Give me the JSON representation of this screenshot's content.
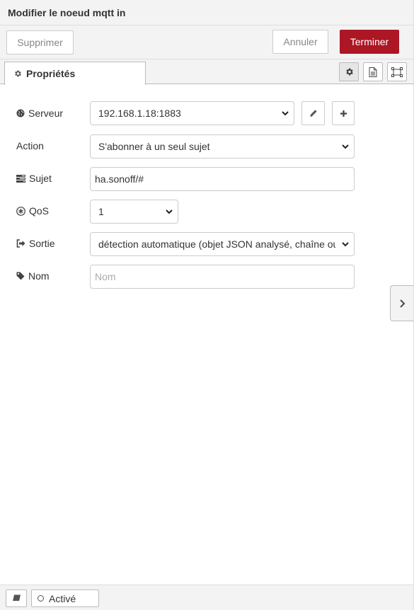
{
  "header": {
    "title": "Modifier le noeud mqtt in"
  },
  "toolbar": {
    "delete_label": "Supprimer",
    "cancel_label": "Annuler",
    "done_label": "Terminer",
    "done_color": "#ad1625"
  },
  "tabs": [
    {
      "label": "Propriétés",
      "icon": "gear-icon"
    }
  ],
  "tab_buttons": [
    {
      "icon": "gear-icon",
      "selected": true
    },
    {
      "icon": "document-icon",
      "selected": false
    },
    {
      "icon": "frame-icon",
      "selected": false
    }
  ],
  "form": {
    "server": {
      "label": "Serveur",
      "icon": "globe-icon",
      "value": "192.168.1.18:1883"
    },
    "action": {
      "label": "Action",
      "value": "S'abonner à un seul sujet"
    },
    "topic": {
      "label": "Sujet",
      "icon": "tasks-icon",
      "value": "ha.sonoff/#"
    },
    "qos": {
      "label": "QoS",
      "icon": "asterisk-circle-icon",
      "value": "1"
    },
    "output": {
      "label": "Sortie",
      "icon": "sign-out-icon",
      "value": "détection automatique (objet JSON analysé, chaîne ou"
    },
    "name": {
      "label": "Nom",
      "icon": "tag-icon",
      "placeholder": "Nom",
      "value": ""
    }
  },
  "footer": {
    "enabled_label": "Activé",
    "book_icon": "book-icon"
  }
}
